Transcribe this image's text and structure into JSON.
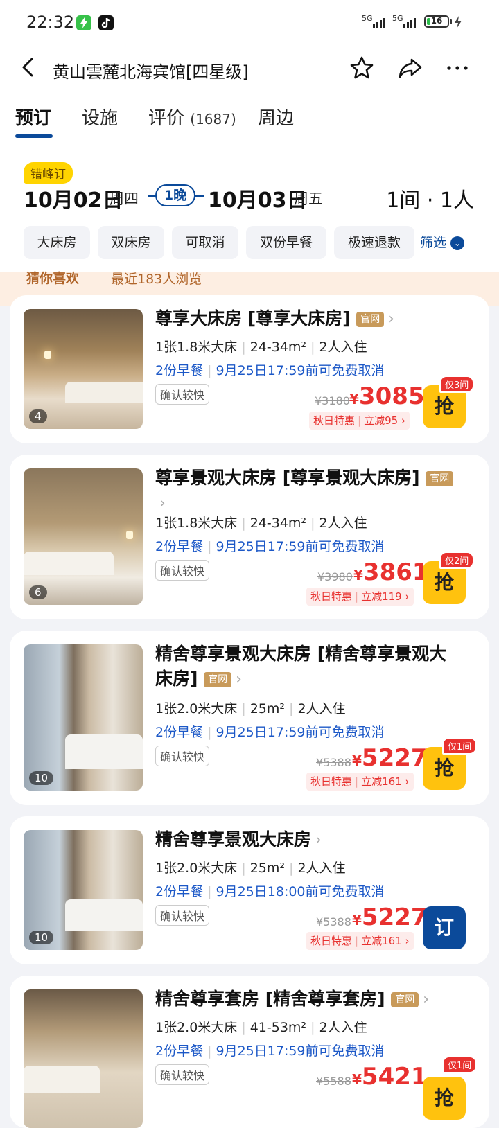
{
  "status_bar": {
    "time": "22:32",
    "signal1": "5G",
    "signal2": "5G",
    "battery": "16"
  },
  "header": {
    "title": "黄山雲麓北海宾馆[四星级]",
    "icons": [
      "back-icon",
      "star-icon",
      "share-icon",
      "more-icon"
    ]
  },
  "tabs": [
    {
      "label": "预订"
    },
    {
      "label": "设施"
    },
    {
      "label": "评价",
      "count": "(1687)"
    },
    {
      "label": "周边"
    }
  ],
  "booking": {
    "badge": "错峰订",
    "checkin_month_day": "10月02日",
    "checkin_week": "周四",
    "nights": "1晚",
    "checkout_month_day": "10月03日",
    "checkout_week": "周五",
    "rooms_guests": "1间 · 1人"
  },
  "filters": {
    "chips": [
      "大床房",
      "双床房",
      "可取消",
      "双份早餐",
      "极速退款"
    ],
    "filter_label": "筛选"
  },
  "banner": {
    "title": "猜你喜欢",
    "subtitle": "最近183人浏览"
  },
  "rooms": [
    {
      "name": "尊享大床房 [尊享大床房]",
      "official": "官网",
      "photo_count": "4",
      "bed": "1张1.8米大床",
      "area": "24-34m²",
      "guests": "2人入住",
      "breakfast": "2份早餐",
      "cancel": "9月25日17:59前可免费取消",
      "confirm": "确认较快",
      "original_price": "¥3180",
      "price": "3085",
      "promo_name": "秋日特惠",
      "promo_discount": "立减95",
      "left": "仅3间",
      "button": "抢"
    },
    {
      "name": "尊享景观大床房 [尊享景观大床房]",
      "official": "官网",
      "photo_count": "6",
      "bed": "1张1.8米大床",
      "area": "24-34m²",
      "guests": "2人入住",
      "breakfast": "2份早餐",
      "cancel": "9月25日17:59前可免费取消",
      "confirm": "确认较快",
      "original_price": "¥3980",
      "price": "3861",
      "promo_name": "秋日特惠",
      "promo_discount": "立减119",
      "left": "仅2间",
      "button": "抢"
    },
    {
      "name": "精舍尊享景观大床房 [精舍尊享景观大床房]",
      "official": "官网",
      "photo_count": "10",
      "bed": "1张2.0米大床",
      "area": "25m²",
      "guests": "2人入住",
      "breakfast": "2份早餐",
      "cancel": "9月25日17:59前可免费取消",
      "confirm": "确认较快",
      "original_price": "¥5388",
      "price": "5227",
      "promo_name": "秋日特惠",
      "promo_discount": "立减161",
      "left": "仅1间",
      "button": "抢"
    },
    {
      "name": "精舍尊享景观大床房",
      "official": "",
      "photo_count": "10",
      "bed": "1张2.0米大床",
      "area": "25m²",
      "guests": "2人入住",
      "breakfast": "2份早餐",
      "cancel": "9月25日18:00前可免费取消",
      "confirm": "确认较快",
      "original_price": "¥5388",
      "price": "5227",
      "promo_name": "秋日特惠",
      "promo_discount": "立减161",
      "left": "",
      "button": "订"
    },
    {
      "name": "精舍尊享套房 [精舍尊享套房]",
      "official": "官网",
      "photo_count": "",
      "bed": "1张2.0米大床",
      "area": "41-53m²",
      "guests": "2人入住",
      "breakfast": "2份早餐",
      "cancel": "9月25日17:59前可免费取消",
      "confirm": "确认较快",
      "original_price": "¥5588",
      "price": "5421",
      "promo_name": "",
      "promo_discount": "",
      "left": "仅1间",
      "button": "抢"
    }
  ],
  "colors": {
    "accent": "#0b4a9a",
    "price": "#e8312f",
    "grab_button": "#ffc20e",
    "official_tag": "#c89a5a"
  }
}
